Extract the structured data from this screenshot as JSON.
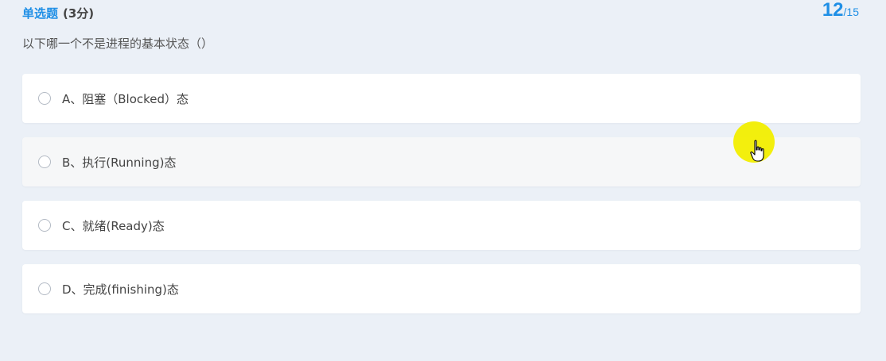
{
  "question_header": {
    "type_label": "单选题",
    "score_label": "(3分)"
  },
  "progress": {
    "current": "12",
    "total": "/15"
  },
  "question": {
    "text": "以下哪一个不是进程的基本状态（）"
  },
  "options": [
    {
      "label": "A、阻塞（Blocked）态"
    },
    {
      "label": "B、执行(Running)态"
    },
    {
      "label": "C、就绪(Ready)态"
    },
    {
      "label": "D、完成(finishing)态"
    }
  ],
  "colors": {
    "accent": "#1f8fe6",
    "background": "#ebf0f7",
    "cursor_highlight": "#f2ee00"
  },
  "icons": {
    "radio": "radio-unselected-icon",
    "cursor": "hand-pointer-icon"
  }
}
